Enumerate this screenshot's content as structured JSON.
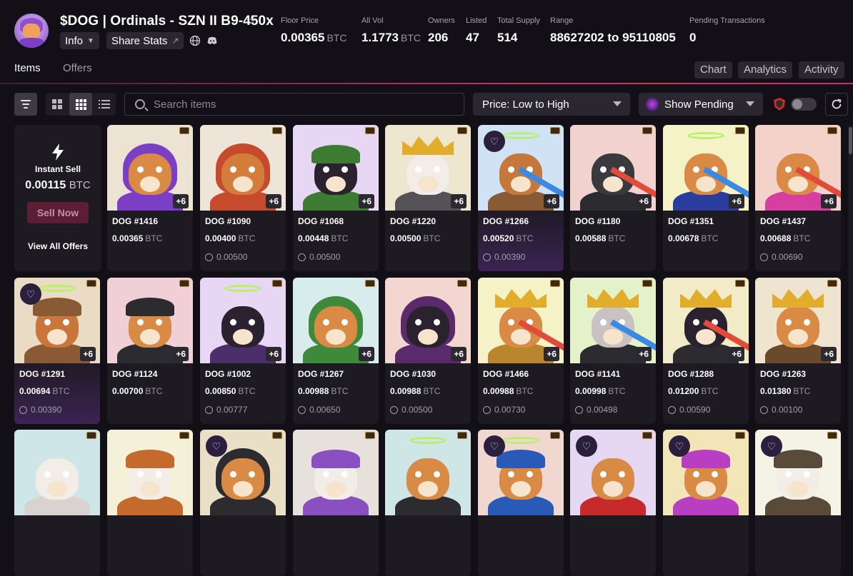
{
  "collection": {
    "title": "$DOG | Ordinals - SZN II B9-450x",
    "info_label": "Info",
    "share_label": "Share Stats"
  },
  "stats": [
    {
      "label": "Floor Price",
      "value": "0.00365",
      "unit": "BTC"
    },
    {
      "label": "All Vol",
      "value": "1.1773",
      "unit": "BTC"
    },
    {
      "label": "Owners",
      "value": "206",
      "unit": ""
    },
    {
      "label": "Listed",
      "value": "47",
      "unit": ""
    },
    {
      "label": "Total Supply",
      "value": "514",
      "unit": ""
    },
    {
      "label": "Range",
      "value": "88627202 to 95110805",
      "unit": ""
    },
    {
      "label": "Pending Transactions",
      "value": "0",
      "unit": ""
    }
  ],
  "tabs": {
    "items": "Items",
    "offers": "Offers"
  },
  "right_tabs": {
    "chart": "Chart",
    "analytics": "Analytics",
    "activity": "Activity"
  },
  "toolbar": {
    "search_placeholder": "Search items",
    "sort_value": "Price: Low to High",
    "pending_value": "Show Pending"
  },
  "instant_sell": {
    "title": "Instant Sell",
    "price": "0.00115",
    "unit": "BTC",
    "button": "Sell Now",
    "view_all": "View All Offers"
  },
  "cards": [
    {
      "name": "DOG #1416",
      "price": "0.00365",
      "unit": "BTC",
      "last": "",
      "badge": "+6",
      "bg": "#ece3d3",
      "fur": "#d98a45",
      "outfit": "#7a3fc4",
      "extra": "hood",
      "highlight": false,
      "fav": false
    },
    {
      "name": "DOG #1090",
      "price": "0.00400",
      "unit": "BTC",
      "last": "0.00500",
      "badge": "+6",
      "bg": "#efe4d8",
      "fur": "#d47c3c",
      "outfit": "#c64a2c",
      "extra": "hood",
      "highlight": false,
      "fav": false
    },
    {
      "name": "DOG #1068",
      "price": "0.00448",
      "unit": "BTC",
      "last": "0.00500",
      "badge": "+6",
      "bg": "#e8d6f5",
      "fur": "#2b2230",
      "outfit": "#3d7a32",
      "extra": "cap",
      "highlight": false,
      "fav": false
    },
    {
      "name": "DOG #1220",
      "price": "0.00500",
      "unit": "BTC",
      "last": "",
      "badge": "+6",
      "bg": "#efe6cf",
      "fur": "#f2ede6",
      "outfit": "#555257",
      "extra": "crown",
      "highlight": false,
      "fav": false
    },
    {
      "name": "DOG #1266",
      "price": "0.00520",
      "unit": "BTC",
      "last": "0.00390",
      "badge": "+6",
      "bg": "#cfe3f4",
      "fur": "#c6773b",
      "outfit": "#8a5a34",
      "extra": "halo-beam",
      "highlight": true,
      "fav": true
    },
    {
      "name": "DOG #1180",
      "price": "0.00588",
      "unit": "BTC",
      "last": "",
      "badge": "+6",
      "bg": "#f2d2ce",
      "fur": "#3a3a3e",
      "outfit": "#2c2b30",
      "extra": "beam",
      "highlight": false,
      "fav": false
    },
    {
      "name": "DOG #1351",
      "price": "0.00678",
      "unit": "BTC",
      "last": "",
      "badge": "+6",
      "bg": "#f5f2c8",
      "fur": "#d98a45",
      "outfit": "#2a3d9c",
      "extra": "halo-beam",
      "highlight": false,
      "fav": false
    },
    {
      "name": "DOG #1437",
      "price": "0.00688",
      "unit": "BTC",
      "last": "0.00690",
      "badge": "+6",
      "bg": "#f3d3c9",
      "fur": "#d98a45",
      "outfit": "#d63fa0",
      "extra": "beam",
      "highlight": false,
      "fav": false
    },
    {
      "name": "DOG #1291",
      "price": "0.00694",
      "unit": "BTC",
      "last": "0.00390",
      "badge": "+6",
      "bg": "#eadcc4",
      "fur": "#c8763a",
      "outfit": "#8a5a34",
      "extra": "cap-halo",
      "highlight": true,
      "fav": true
    },
    {
      "name": "DOG #1124",
      "price": "0.00700",
      "unit": "BTC",
      "last": "",
      "badge": "+6",
      "bg": "#f0cfd6",
      "fur": "#d98a45",
      "outfit": "#2c2b30",
      "extra": "cap",
      "highlight": false,
      "fav": false
    },
    {
      "name": "DOG #1002",
      "price": "0.00850",
      "unit": "BTC",
      "last": "0.00777",
      "badge": "+6",
      "bg": "#e8d6f5",
      "fur": "#2b2230",
      "outfit": "#4a2f6a",
      "extra": "halo",
      "highlight": false,
      "fav": false
    },
    {
      "name": "DOG #1267",
      "price": "0.00988",
      "unit": "BTC",
      "last": "0.00650",
      "badge": "+6",
      "bg": "#d8ecec",
      "fur": "#d98a45",
      "outfit": "#3e8a3a",
      "extra": "hood",
      "highlight": false,
      "fav": false
    },
    {
      "name": "DOG #1030",
      "price": "0.00988",
      "unit": "BTC",
      "last": "0.00500",
      "badge": "+6",
      "bg": "#f2d6cf",
      "fur": "#2b2230",
      "outfit": "#5a2a6a",
      "extra": "hood",
      "highlight": false,
      "fav": false
    },
    {
      "name": "DOG #1466",
      "price": "0.00988",
      "unit": "BTC",
      "last": "0.00730",
      "badge": "+6",
      "bg": "#f5f2c8",
      "fur": "#d98a45",
      "outfit": "#b8862c",
      "extra": "crown-beam",
      "highlight": false,
      "fav": false
    },
    {
      "name": "DOG #1141",
      "price": "0.00998",
      "unit": "BTC",
      "last": "0.00498",
      "badge": "+6",
      "bg": "#e3f2c9",
      "fur": "#c8c2c4",
      "outfit": "#2c2b30",
      "extra": "crown-beam",
      "highlight": false,
      "fav": false
    },
    {
      "name": "DOG #1288",
      "price": "0.01200",
      "unit": "BTC",
      "last": "0.00590",
      "badge": "+6",
      "bg": "#f2ebc8",
      "fur": "#2b2230",
      "outfit": "#2c2b30",
      "extra": "crown-beam",
      "highlight": false,
      "fav": false
    },
    {
      "name": "DOG #1263",
      "price": "0.01380",
      "unit": "BTC",
      "last": "0.00100",
      "badge": "+6",
      "bg": "#efe4d0",
      "fur": "#d98a45",
      "outfit": "#6a4a2a",
      "extra": "crown",
      "highlight": false,
      "fav": false
    },
    {
      "name": "",
      "price": "",
      "unit": "",
      "last": "",
      "badge": "",
      "bg": "#cfe6e8",
      "fur": "#f2ede6",
      "outfit": "#d8d2d0",
      "extra": "",
      "highlight": false,
      "fav": false
    },
    {
      "name": "",
      "price": "",
      "unit": "",
      "last": "",
      "badge": "",
      "bg": "#f5f0d8",
      "fur": "#f2ede6",
      "outfit": "#c46a2c",
      "extra": "cap",
      "highlight": false,
      "fav": false
    },
    {
      "name": "",
      "price": "",
      "unit": "",
      "last": "",
      "badge": "",
      "bg": "#e8dfc6",
      "fur": "#d98a45",
      "outfit": "#2c2b30",
      "extra": "hood",
      "highlight": false,
      "fav": true
    },
    {
      "name": "",
      "price": "",
      "unit": "",
      "last": "",
      "badge": "",
      "bg": "#e6e1da",
      "fur": "#f2ede6",
      "outfit": "#8a4fc0",
      "extra": "cap",
      "highlight": false,
      "fav": false
    },
    {
      "name": "",
      "price": "",
      "unit": "",
      "last": "",
      "badge": "",
      "bg": "#cfe6e6",
      "fur": "#d98a45",
      "outfit": "#2c2b30",
      "extra": "halo",
      "highlight": false,
      "fav": false
    },
    {
      "name": "",
      "price": "",
      "unit": "",
      "last": "",
      "badge": "",
      "bg": "#f0d8d0",
      "fur": "#d98a45",
      "outfit": "#2a5ab8",
      "extra": "cap-halo",
      "highlight": false,
      "fav": true
    },
    {
      "name": "",
      "price": "",
      "unit": "",
      "last": "",
      "badge": "",
      "bg": "#e6d8f2",
      "fur": "#d98a45",
      "outfit": "#c62a2a",
      "extra": "",
      "highlight": false,
      "fav": true
    },
    {
      "name": "",
      "price": "",
      "unit": "",
      "last": "",
      "badge": "",
      "bg": "#f2e6b8",
      "fur": "#d98a45",
      "outfit": "#b83fc4",
      "extra": "cap",
      "highlight": false,
      "fav": true
    },
    {
      "name": "",
      "price": "",
      "unit": "",
      "last": "",
      "badge": "",
      "bg": "#f5f2e6",
      "fur": "#f2ede6",
      "outfit": "#5a4a3a",
      "extra": "cap",
      "highlight": false,
      "fav": true
    }
  ]
}
